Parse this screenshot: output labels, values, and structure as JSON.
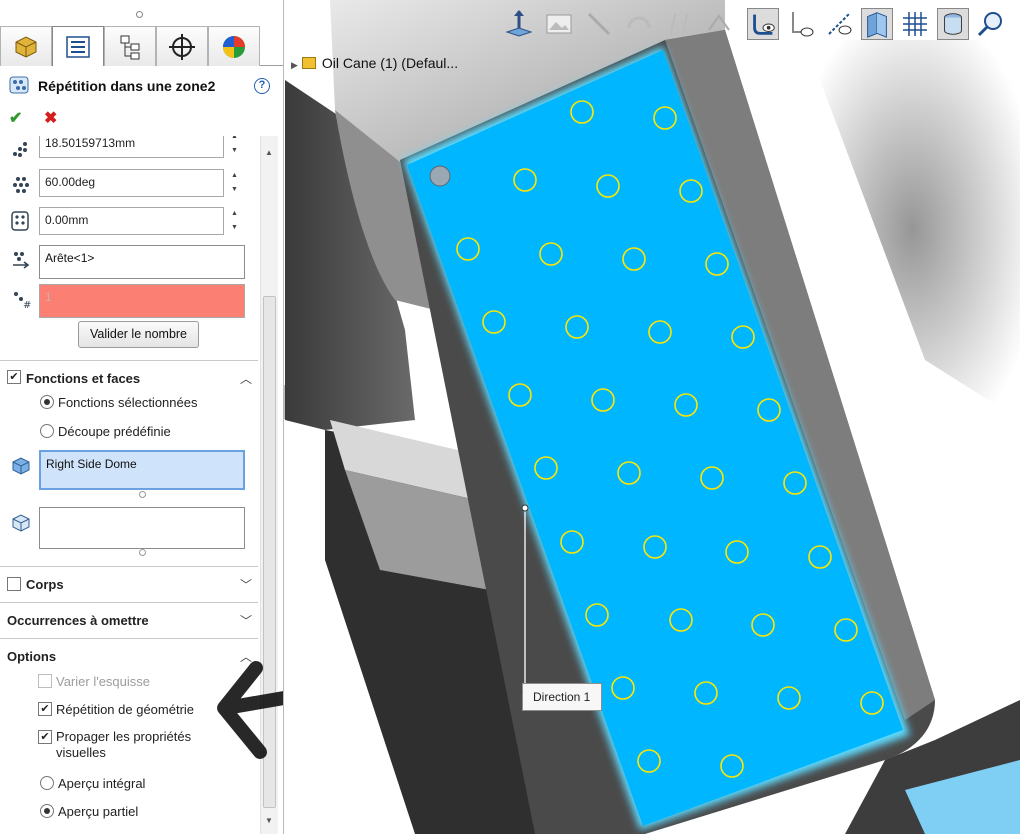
{
  "panel": {
    "tabs": [
      {
        "name": "featuremanager-tab",
        "icon": "part-icon"
      },
      {
        "name": "propertymanager-tab",
        "icon": "property-manager-icon"
      },
      {
        "name": "configurationmanager-tab",
        "icon": "configuration-icon"
      },
      {
        "name": "dimxpert-tab",
        "icon": "crosshair-icon"
      },
      {
        "name": "display-manager-tab",
        "icon": "appearance-icon"
      }
    ],
    "title": "Répétition dans une zone2",
    "help": "?",
    "fields": {
      "spacing": "18.50159713mm",
      "angle": "60.00deg",
      "offset": "0.00mm",
      "direction_edge": "Arête<1>",
      "count": "1"
    },
    "validate_button": "Valider le nombre",
    "sections": {
      "features_faces": "Fonctions et faces",
      "bodies": "Corps",
      "skip": "Occurrences à omettre",
      "options": "Options"
    },
    "features_faces": {
      "selected_features": "Fonctions sélectionnées",
      "predefined_cut": "Découpe prédéfinie",
      "faces_list": "Right Side Dome"
    },
    "options": {
      "vary_sketch": "Varier l'esquisse",
      "geometry_pattern": "Répétition de géométrie",
      "propagate_props": "Propager les propriétés visuelles",
      "full_preview": "Aperçu intégral",
      "partial_preview": "Aperçu partiel"
    }
  },
  "viewport": {
    "tree_tag": "Oil Cane (1)  (Defaul...",
    "direction_label": "Direction 1"
  },
  "colors": {
    "face_highlight": "#00b7ff",
    "hole_sketch": "#ffe600",
    "error_field": "#fb7f72"
  }
}
